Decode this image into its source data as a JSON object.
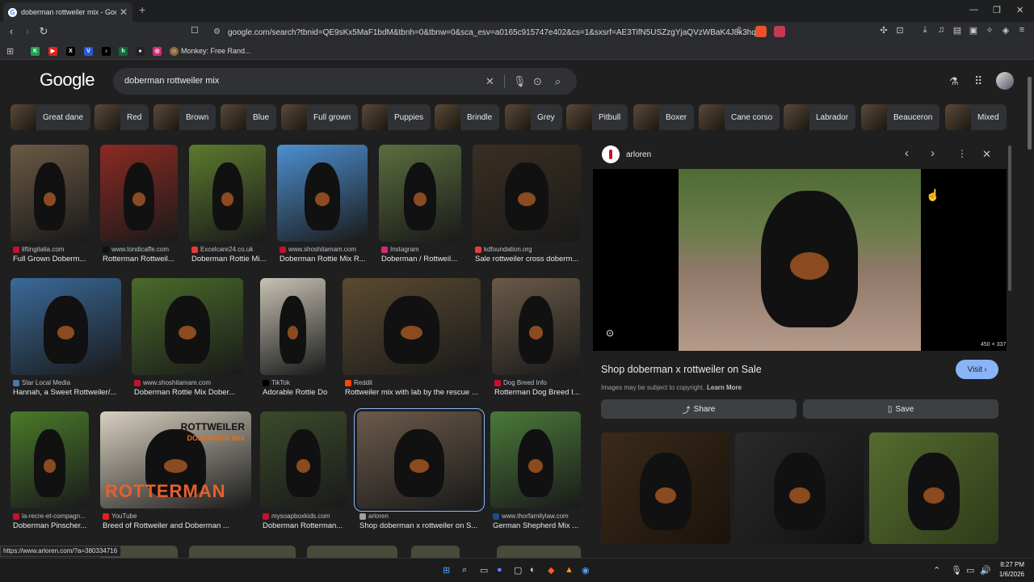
{
  "browser": {
    "tab_title": "doberman rottweiler mix - Goog",
    "url": "google.com/search?tbnid=QE9sKx5MaF1bdM&tbnh=0&tbnw=0&sca_esv=a0165c915747e402&cs=1&sxsrf=AE3TifN5USZzgYjaQVzWBaK4J8x3hqu...",
    "bookmark_label": "Monkey: Free Rand..."
  },
  "search": {
    "logo": "Google",
    "query": "doberman rottweiler mix"
  },
  "chips": [
    "Great dane",
    "Red",
    "Brown",
    "Blue",
    "Full grown",
    "Puppies",
    "Brindle",
    "Grey",
    "Pitbull",
    "Boxer",
    "Cane corso",
    "Labrador",
    "Beauceron",
    "Mixed"
  ],
  "results": [
    {
      "source": "liftingitalia.com",
      "caption": "Full Grown Doberm..."
    },
    {
      "source": "www.tondicaffe.com",
      "caption": "Rotterman Rottweil..."
    },
    {
      "source": "Excelcare24.co.uk",
      "caption": "Doberman Rottie Mi..."
    },
    {
      "source": "www.shoshitamam.com",
      "caption": "Doberman Rottie Mix R..."
    },
    {
      "source": "Instagram",
      "caption": "Doberman / Rottweil..."
    },
    {
      "source": "kdfoundation.org",
      "caption": "Sale rottweiler cross doberm..."
    },
    {
      "source": "Star Local Media",
      "caption": "Hannah, a Sweet Rottweiler/..."
    },
    {
      "source": "www.shoshitamam.com",
      "caption": "Doberman Rottie Mix Dober..."
    },
    {
      "source": "TikTok",
      "caption": "Adorable Rottie Do..."
    },
    {
      "source": "Reddit",
      "caption": "Rottweiler mix with lab by the rescue ..."
    },
    {
      "source": "Dog Breed Info",
      "caption": "Rotterman Dog Breed I..."
    },
    {
      "source": "la-recre-et-compagn...",
      "caption": "Doberman Pinscher..."
    },
    {
      "source": "YouTube",
      "caption": "Breed of Rottweiler and Doberman ..."
    },
    {
      "source": "mysoapboxkids.com",
      "caption": "Doberman Rotterman..."
    },
    {
      "source": "arloren",
      "caption": "Shop doberman x rottweiler on S..."
    },
    {
      "source": "www.thorfamilylaw.com",
      "caption": "German Shepherd Mix ..."
    }
  ],
  "thumb_overlay": {
    "line1": "ROTTWEILER",
    "line2": "DOBERMAN MIX",
    "line3": "ROTTERMAN"
  },
  "panel": {
    "site": "arloren",
    "title": "Shop doberman x rottweiler on Sale",
    "visit": "Visit",
    "dims": "450 × 337",
    "copyright": "Images may be subject to copyright.",
    "learn_more": "Learn More",
    "share": "Share",
    "save": "Save"
  },
  "status_url": "https://www.arloren.com/?a=380334716",
  "clock": {
    "time": "8:27 PM",
    "date": "1/6/2026"
  },
  "colors": {
    "accent": "#8ab4f8",
    "visit_bg": "#8ab4f8",
    "page_bg": "#1f1f1f"
  }
}
